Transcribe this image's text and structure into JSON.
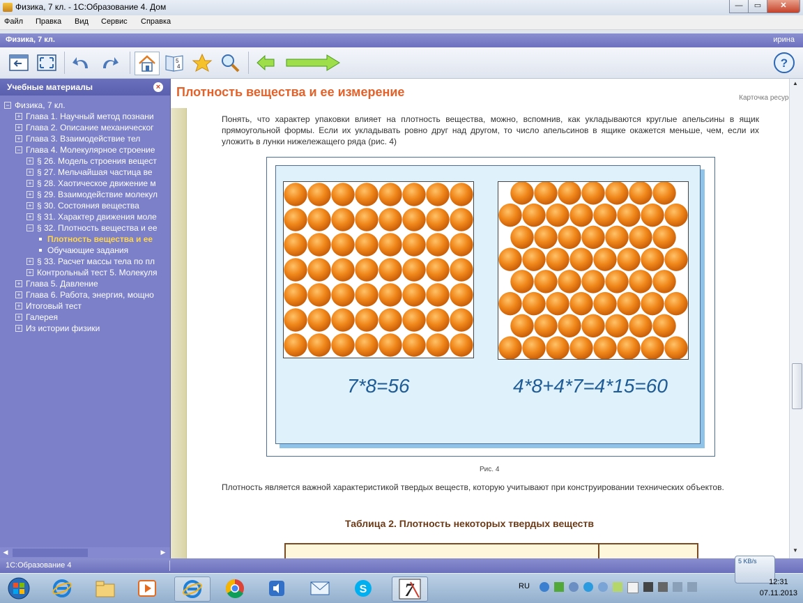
{
  "window": {
    "title": "Физика, 7 кл. - 1С:Образование 4. Дом",
    "controls": [
      "—",
      "▭",
      "✕"
    ]
  },
  "menu": [
    "Файл",
    "Правка",
    "Вид",
    "Сервис",
    "Справка"
  ],
  "app_header": {
    "title": "Физика, 7 кл.",
    "user": "ирина"
  },
  "toolbar": {
    "buttons": [
      "panel-toggle-icon",
      "fullscreen-icon",
      "undo-icon",
      "redo-icon",
      "home-icon",
      "book-pages-icon",
      "favorites-star-icon",
      "search-magnifier-icon",
      "back-arrow-icon",
      "forward-arrow-icon",
      "help-icon"
    ],
    "help_label": "?"
  },
  "sidebar": {
    "title": "Учебные материалы",
    "close": "×",
    "tree": [
      {
        "level": 0,
        "box": "−",
        "label": "Физика, 7 кл."
      },
      {
        "level": 1,
        "box": "+",
        "label": "Глава 1. Научный метод познани"
      },
      {
        "level": 1,
        "box": "+",
        "label": "Глава 2. Описание механическог"
      },
      {
        "level": 1,
        "box": "+",
        "label": "Глава 3. Взаимодействие тел"
      },
      {
        "level": 1,
        "box": "−",
        "label": "Глава 4. Молекулярное строение"
      },
      {
        "level": 2,
        "box": "+",
        "label": "§ 26. Модель строения вещест"
      },
      {
        "level": 2,
        "box": "+",
        "label": "§ 27. Мельчайшая частица ве"
      },
      {
        "level": 2,
        "box": "+",
        "label": "§ 28. Хаотическое движение м"
      },
      {
        "level": 2,
        "box": "+",
        "label": "§ 29. Взаимодействие молекул"
      },
      {
        "level": 2,
        "box": "+",
        "label": "§ 30. Состояния вещества"
      },
      {
        "level": 2,
        "box": "+",
        "label": "§ 31. Характер движения моле"
      },
      {
        "level": 2,
        "box": "−",
        "label": "§ 32. Плотность вещества и ее"
      },
      {
        "level": 3,
        "box": "",
        "label": "Плотность вещества и ее",
        "selected": true
      },
      {
        "level": 3,
        "box": "",
        "label": "Обучающие задания"
      },
      {
        "level": 2,
        "box": "+",
        "label": "§ 33. Расчет массы тела по пл"
      },
      {
        "level": 2,
        "box": "+",
        "label": "Контрольный тест 5. Молекуля"
      },
      {
        "level": 1,
        "box": "+",
        "label": "Глава 5. Давление"
      },
      {
        "level": 1,
        "box": "+",
        "label": "Глава 6. Работа, энергия, мощно"
      },
      {
        "level": 1,
        "box": "+",
        "label": "Итоговый тест"
      },
      {
        "level": 1,
        "box": "+",
        "label": "Галерея"
      },
      {
        "level": 1,
        "box": "+",
        "label": "Из истории физики"
      }
    ]
  },
  "content": {
    "title": "Плотность вещества и ее измерение",
    "card_link": "Карточка ресурса",
    "para1": "Понять, что характер упаковки влияет на плотность вещества, можно, вспомнив, как укладываются круглые апельсины в ящик прямоугольной формы. Если их укладывать ровно друг над другом, то число апельсинов в ящике окажется меньше, чем, если их уложить в лунки нижележащего ряда (рис. 4)",
    "figure": {
      "left_eq": "7*8=56",
      "right_eq": "4*8+4*7=4*15=60",
      "caption": "Рис. 4",
      "left_grid": {
        "rows": 7,
        "cols": 8
      },
      "right_grid": {
        "rows": 8,
        "row_counts": [
          7,
          8,
          7,
          8,
          7,
          8,
          7,
          8
        ]
      }
    },
    "para2": "Плотность является важной характеристикой твердых веществ, которую учитывают при конструировании технических объектов.",
    "table_title": "Таблица 2. Плотность некоторых твердых веществ"
  },
  "status_bar": {
    "text": "1С:Образование 4"
  },
  "taskbar": {
    "apps": [
      "start-orb-icon",
      "internet-explorer-icon",
      "file-explorer-icon",
      "media-player-icon",
      "internet-explorer-icon-2",
      "chrome-icon",
      "audio-app-icon",
      "mail-icon",
      "skype-icon",
      "1c-education-icon"
    ],
    "lang": "RU",
    "net_speed": "5 KB/s",
    "time": "12:31",
    "date": "07.11.2013"
  },
  "colors": {
    "accent_title": "#e2622b",
    "sidebar_bg": "#7b80c9",
    "selected_item": "#ffd54a",
    "orange": "#f0871a",
    "equation": "#1f5b95"
  }
}
